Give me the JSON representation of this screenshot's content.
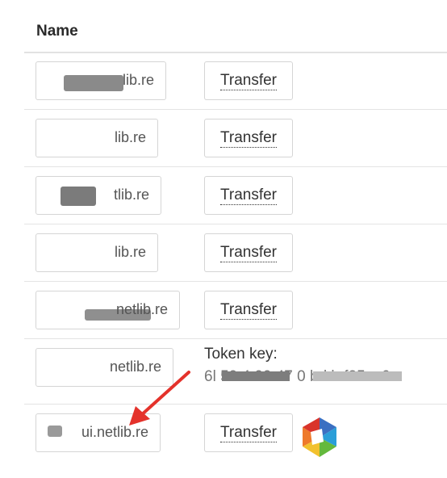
{
  "table": {
    "header": "Name",
    "rows": [
      {
        "domain": "lib.re",
        "action": "Transfer"
      },
      {
        "domain": "lib.re",
        "action": "Transfer"
      },
      {
        "domain": "tlib.re",
        "action": "Transfer"
      },
      {
        "domain": "lib.re",
        "action": "Transfer"
      },
      {
        "domain": "netlib.re",
        "action": "Transfer"
      },
      {
        "domain": "netlib.re",
        "token_label": "Token key:",
        "token_value": "6l 59 4 00 47 0 bd b f25ec6"
      },
      {
        "domain": "ui.netlib.re",
        "action": "Transfer"
      }
    ]
  },
  "icons": {
    "arrow": "red-arrow-icon",
    "logo": "netlib-logo-icon"
  },
  "colors": {
    "arrow": "#e4322b",
    "blur": "#8c8c8c"
  }
}
